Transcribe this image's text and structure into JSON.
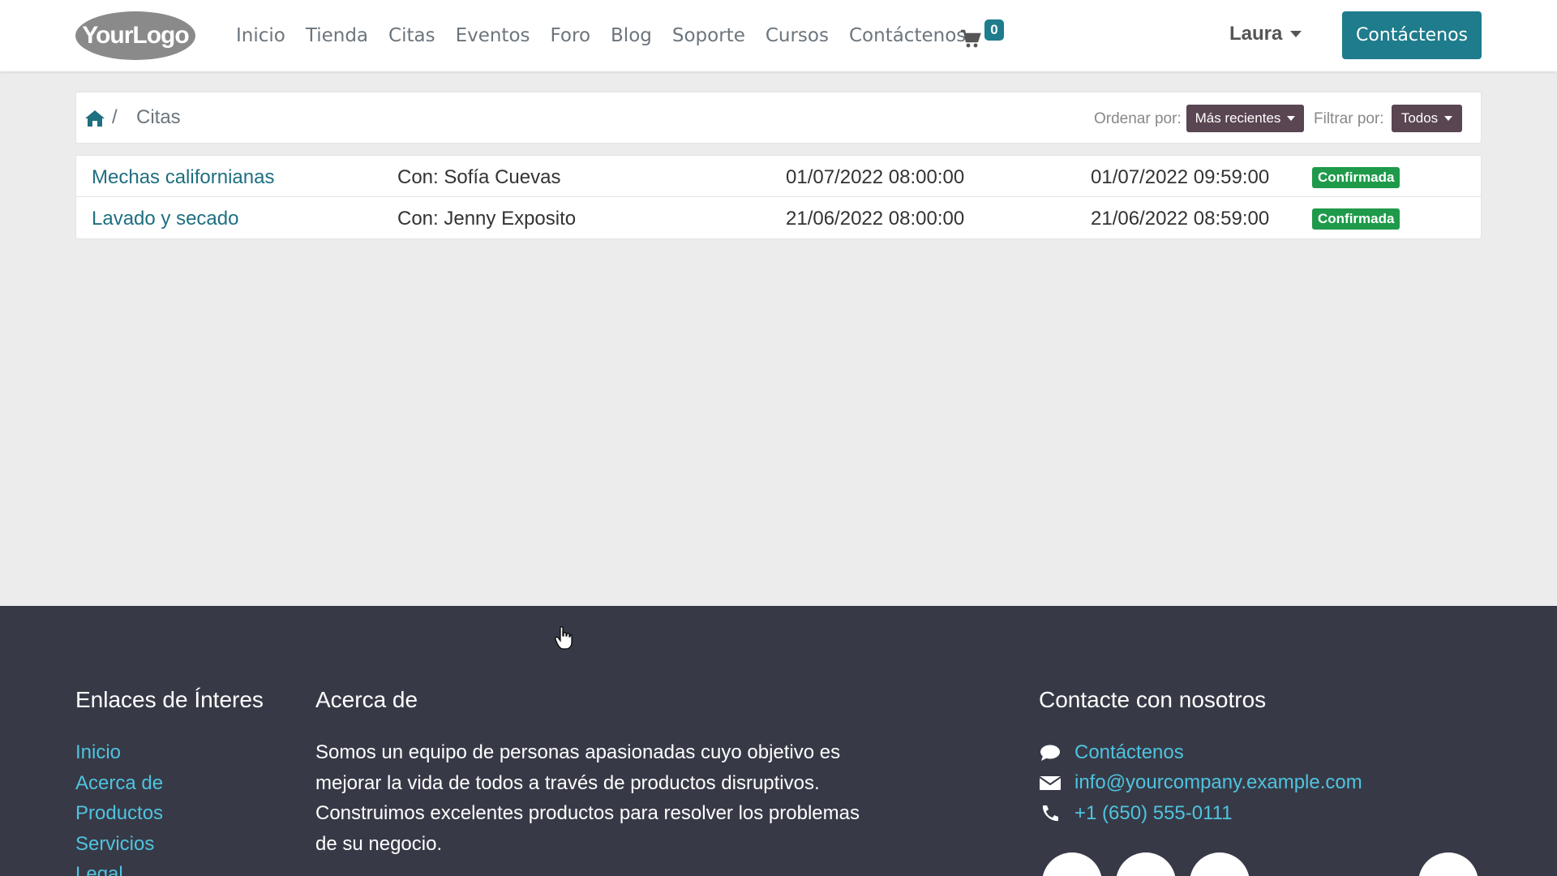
{
  "header": {
    "logo_text": "YourLogo",
    "nav": [
      "Inicio",
      "Tienda",
      "Citas",
      "Eventos",
      "Foro",
      "Blog",
      "Soporte",
      "Cursos",
      "Contáctenos"
    ],
    "cart_count": "0",
    "user_name": "Laura",
    "cta_label": "Contáctenos"
  },
  "breadcrumb": {
    "current": "Citas",
    "separator": "/"
  },
  "controls": {
    "sort_label": "Ordenar por:",
    "sort_value": "Más recientes",
    "filter_label": "Filtrar por:",
    "filter_value": "Todos"
  },
  "appointments": [
    {
      "name": "Mechas californianas",
      "with": "Con: Sofía Cuevas",
      "start": "01/07/2022 08:00:00",
      "end": "01/07/2022 09:59:00",
      "status": "Confirmada"
    },
    {
      "name": "Lavado y secado",
      "with": "Con: Jenny Exposito",
      "start": "21/06/2022 08:00:00",
      "end": "21/06/2022 08:59:00",
      "status": "Confirmada"
    }
  ],
  "footer": {
    "links_title": "Enlaces de Ínteres",
    "links": [
      "Inicio",
      "Acerca de",
      "Productos",
      "Servicios",
      "Legal"
    ],
    "about_title": "Acerca de",
    "about_text": "Somos un equipo de personas apasionadas cuyo objetivo es mejorar la vida de todos a través de productos disruptivos. Construimos excelentes productos para resolver los problemas de su negocio.",
    "contact_title": "Contacte con nosotros",
    "contact": {
      "link": "Contáctenos",
      "email": "info@yourcompany.example.com",
      "phone": "+1 (650) 555-0111"
    }
  },
  "colors": {
    "accent": "#1e7c8c",
    "footer_bg": "#373a46",
    "status_confirmed": "#1e9a4a",
    "dropdown_bg": "#5a4552"
  }
}
